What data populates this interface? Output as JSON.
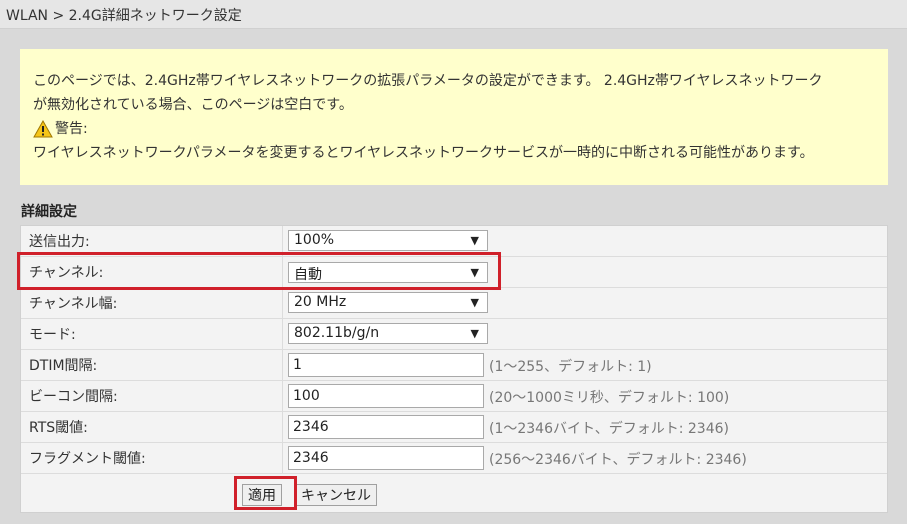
{
  "breadcrumb": "WLAN > 2.4G詳細ネットワーク設定",
  "notice": {
    "line1": "このページでは、2.4GHz帯ワイヤレスネットワークの拡張パラメータの設定ができます。 2.4GHz帯ワイヤレスネットワーク",
    "line2": "が無効化されている場合、このページは空白です。",
    "warning_label": "警告:",
    "warning_text": "ワイヤレスネットワークパラメータを変更するとワイヤレスネットワークサービスが一時的に中断される可能性があります。"
  },
  "section_title": "詳細設定",
  "fields": {
    "tx_power": {
      "label": "送信出力:",
      "value": "100%"
    },
    "channel": {
      "label": "チャンネル:",
      "value": "自動"
    },
    "channel_width": {
      "label": "チャンネル幅:",
      "value": "20 MHz"
    },
    "mode": {
      "label": "モード:",
      "value": "802.11b/g/n"
    },
    "dtim": {
      "label": "DTIM間隔:",
      "value": "1",
      "hint": "(1～255、デフォルト: 1)"
    },
    "beacon": {
      "label": "ビーコン間隔:",
      "value": "100",
      "hint": "(20～1000ミリ秒、デフォルト: 100)"
    },
    "rts": {
      "label": "RTS閾値:",
      "value": "2346",
      "hint": "(1～2346バイト、デフォルト: 2346)"
    },
    "frag": {
      "label": "フラグメント閾値:",
      "value": "2346",
      "hint": "(256～2346バイト、デフォルト: 2346)"
    }
  },
  "buttons": {
    "apply": "適用",
    "cancel": "キャンセル"
  },
  "colors": {
    "notice_bg": "#ffffcc",
    "highlight": "#d0202a",
    "page_bg": "#d9d9d9"
  },
  "icons": {
    "warning": "warning-icon",
    "dropdown": "chevron-down-icon"
  }
}
